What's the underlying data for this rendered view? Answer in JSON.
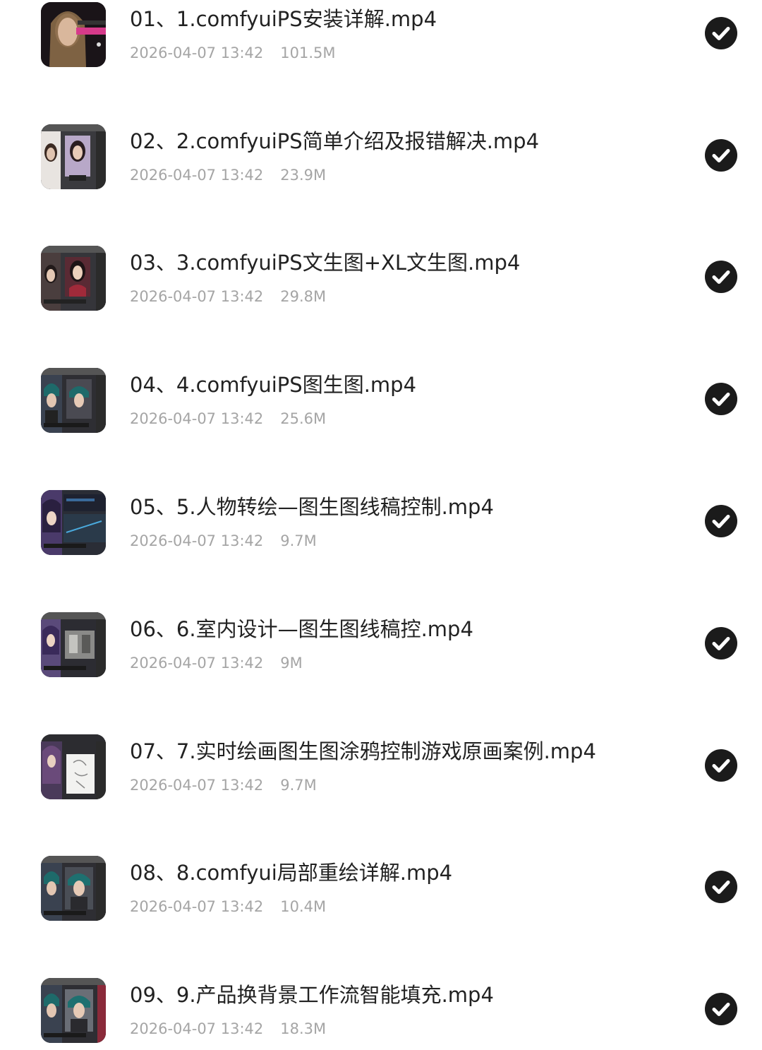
{
  "colors": {
    "title_text": "#222222",
    "meta_text": "#a5a5a5",
    "check_bg": "#1b1b1b",
    "check_mark": "#ffffff",
    "background": "#ffffff"
  },
  "check_icon": "check-circle-icon",
  "files": [
    {
      "title": "01、1.comfyuiPS安装详解.mp4",
      "date": "2026-04-07 13:42",
      "size": "101.5M",
      "checked": true
    },
    {
      "title": "02、2.comfyuiPS简单介绍及报错解决.mp4",
      "date": "2026-04-07 13:42",
      "size": "23.9M",
      "checked": true
    },
    {
      "title": "03、3.comfyuiPS文生图+XL文生图.mp4",
      "date": "2026-04-07 13:42",
      "size": "29.8M",
      "checked": true
    },
    {
      "title": "04、4.comfyuiPS图生图.mp4",
      "date": "2026-04-07 13:42",
      "size": "25.6M",
      "checked": true
    },
    {
      "title": "05、5.人物转绘—图生图线稿控制.mp4",
      "date": "2026-04-07 13:42",
      "size": "9.7M",
      "checked": true
    },
    {
      "title": "06、6.室内设计—图生图线稿控.mp4",
      "date": "2026-04-07 13:42",
      "size": "9M",
      "checked": true
    },
    {
      "title": "07、7.实时绘画图生图涂鸦控制游戏原画案例.mp4",
      "date": "2026-04-07 13:42",
      "size": "9.7M",
      "checked": true
    },
    {
      "title": "08、8.comfyui局部重绘详解.mp4",
      "date": "2026-04-07 13:42",
      "size": "10.4M",
      "checked": true
    },
    {
      "title": "09、9.产品换背景工作流智能填充.mp4",
      "date": "2026-04-07 13:42",
      "size": "18.3M",
      "checked": true
    }
  ]
}
